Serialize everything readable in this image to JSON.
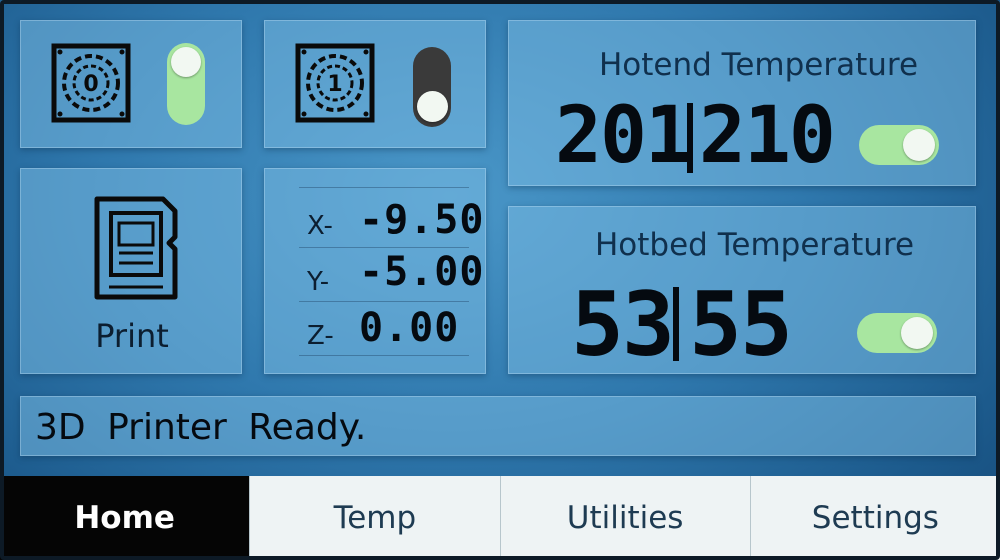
{
  "fans": [
    {
      "label": "0",
      "enabled": true
    },
    {
      "label": "1",
      "enabled": false
    }
  ],
  "print_label": "Print",
  "hotend": {
    "title": "Hotend Temperature",
    "current": "201",
    "target": "210",
    "heater_on": true
  },
  "hotbed": {
    "title": "Hotbed Temperature",
    "current": "53",
    "target": "55",
    "heater_on": true
  },
  "axes": [
    {
      "label": "X-",
      "value": "-9.50"
    },
    {
      "label": "Y-",
      "value": "-5.00"
    },
    {
      "label": "Z-",
      "value": "0.00"
    }
  ],
  "status": "3D Printer Ready.",
  "tabs": [
    {
      "label": "Home",
      "active": true
    },
    {
      "label": "Temp",
      "active": false
    },
    {
      "label": "Utilities",
      "active": false
    },
    {
      "label": "Settings",
      "active": false
    }
  ],
  "colors": {
    "toggle_on": "#a8e6a0",
    "toggle_off": "#3a3a3a",
    "panel": "#7ab9e1"
  }
}
